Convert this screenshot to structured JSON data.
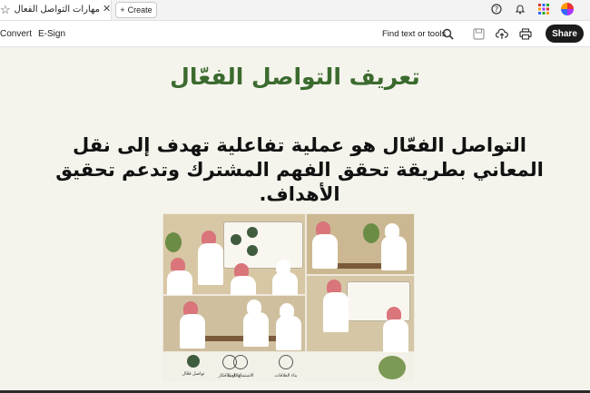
{
  "browser": {
    "tab_title": "مهارات التواصل الفعال الاكا...",
    "create_label": "Create"
  },
  "toolbar": {
    "convert_label": "Convert",
    "esign_label": "E-Sign",
    "find_label": "Find text or tools",
    "share_label": "Share"
  },
  "slide": {
    "title": "تعريف التواصل الفعّال",
    "body": "التواصل الفعّال هو عملية تفاعلية تهدف إلى نقل المعاني بطريقة تحقق الفهم المشترك وتدعم تحقيق الأهداف."
  },
  "illustration": {
    "footer_labels": [
      "تبادل الأفكار",
      "بناء العلاقات",
      "الاستماع الجيد",
      "تواصل فعّال"
    ]
  },
  "icons": [
    "star-icon",
    "close-icon",
    "plus-icon",
    "help-icon",
    "bell-icon",
    "apps-grid-icon",
    "avatar",
    "search-icon",
    "save-icon",
    "upload-icon",
    "print-icon"
  ]
}
